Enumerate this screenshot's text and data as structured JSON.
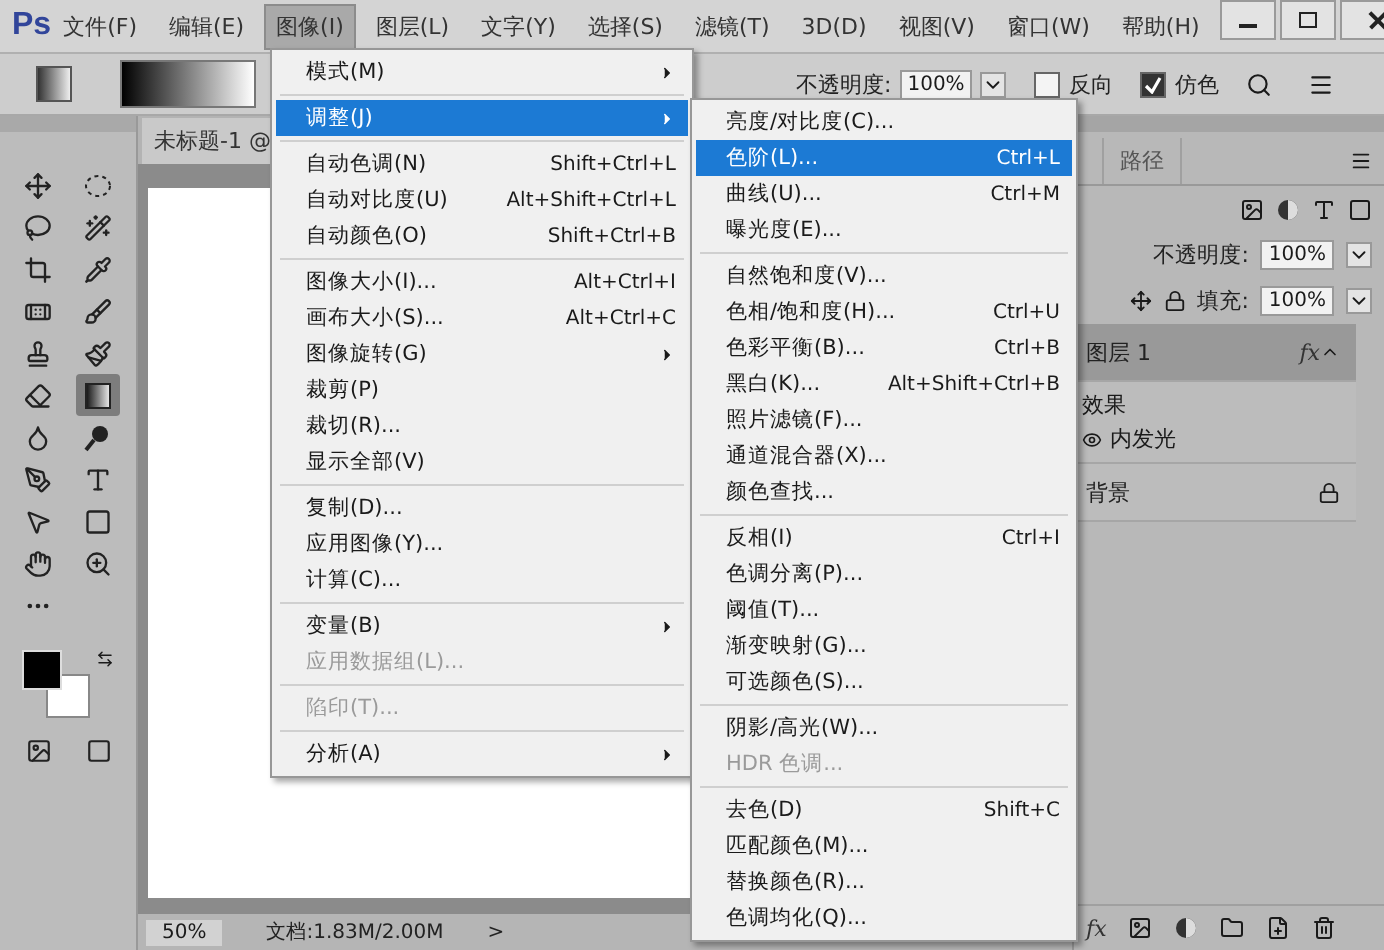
{
  "app": {
    "logo": "Ps"
  },
  "menu_bar": [
    {
      "label": "文件(F)",
      "selected": false
    },
    {
      "label": "编辑(E)",
      "selected": false
    },
    {
      "label": "图像(I)",
      "selected": true
    },
    {
      "label": "图层(L)",
      "selected": false
    },
    {
      "label": "文字(Y)",
      "selected": false
    },
    {
      "label": "选择(S)",
      "selected": false
    },
    {
      "label": "滤镜(T)",
      "selected": false
    },
    {
      "label": "3D(D)",
      "selected": false
    },
    {
      "label": "视图(V)",
      "selected": false
    },
    {
      "label": "窗口(W)",
      "selected": false
    },
    {
      "label": "帮助(H)",
      "selected": false
    }
  ],
  "options_bar": {
    "opacity_label": "不透明度:",
    "opacity": "100%",
    "checkboxes": [
      {
        "label": "反向",
        "checked": false
      },
      {
        "label": "仿色",
        "checked": true
      }
    ]
  },
  "toolbar": {
    "tools": [
      {
        "kind": "move",
        "selected": false
      },
      {
        "kind": "marquee",
        "selected": false
      },
      {
        "kind": "lasso",
        "selected": false
      },
      {
        "kind": "wand",
        "selected": false
      },
      {
        "kind": "crop",
        "selected": false
      },
      {
        "kind": "eyedropper",
        "selected": false
      },
      {
        "kind": "bandage",
        "selected": false
      },
      {
        "kind": "brush",
        "selected": false
      },
      {
        "kind": "stamp",
        "selected": false
      },
      {
        "kind": "history",
        "selected": false
      },
      {
        "kind": "eraser",
        "selected": false
      },
      {
        "kind": "gradient",
        "selected": true
      },
      {
        "kind": "drop",
        "selected": false
      },
      {
        "kind": "dodge",
        "selected": false
      },
      {
        "kind": "pen",
        "selected": false
      },
      {
        "kind": "type",
        "selected": false
      },
      {
        "kind": "pointer",
        "selected": false
      },
      {
        "kind": "rectangle",
        "selected": false
      },
      {
        "kind": "hand",
        "selected": false
      },
      {
        "kind": "zoom",
        "selected": false
      },
      {
        "kind": "more",
        "selected": false
      }
    ]
  },
  "document": {
    "tab": "未标题-1 @",
    "zoom": "50%",
    "info": "文档:1.83M/2.00M",
    "arrow": ">"
  },
  "image_menu": {
    "groups": [
      [
        {
          "label": "模式(M)",
          "submenu": true,
          "selected": false,
          "disabled": false
        }
      ],
      [
        {
          "label": "调整(J)",
          "submenu": true,
          "selected": true,
          "disabled": false
        }
      ],
      [
        {
          "label": "自动色调(N)",
          "shortcut": "Shift+Ctrl+L",
          "submenu": false,
          "selected": false,
          "disabled": false
        },
        {
          "label": "自动对比度(U)",
          "shortcut": "Alt+Shift+Ctrl+L",
          "submenu": false,
          "selected": false,
          "disabled": false
        },
        {
          "label": "自动颜色(O)",
          "shortcut": "Shift+Ctrl+B",
          "submenu": false,
          "selected": false,
          "disabled": false
        }
      ],
      [
        {
          "label": "图像大小(I)...",
          "shortcut": "Alt+Ctrl+I",
          "submenu": false,
          "selected": false,
          "disabled": false
        },
        {
          "label": "画布大小(S)...",
          "shortcut": "Alt+Ctrl+C",
          "submenu": false,
          "selected": false,
          "disabled": false
        },
        {
          "label": "图像旋转(G)",
          "submenu": true,
          "selected": false,
          "disabled": false
        },
        {
          "label": "裁剪(P)",
          "submenu": false,
          "selected": false,
          "disabled": false
        },
        {
          "label": "裁切(R)...",
          "submenu": false,
          "selected": false,
          "disabled": false
        },
        {
          "label": "显示全部(V)",
          "submenu": false,
          "selected": false,
          "disabled": false
        }
      ],
      [
        {
          "label": "复制(D)...",
          "submenu": false,
          "selected": false,
          "disabled": false
        },
        {
          "label": "应用图像(Y)...",
          "submenu": false,
          "selected": false,
          "disabled": false
        },
        {
          "label": "计算(C)...",
          "submenu": false,
          "selected": false,
          "disabled": false
        }
      ],
      [
        {
          "label": "变量(B)",
          "submenu": true,
          "selected": false,
          "disabled": false
        },
        {
          "label": "应用数据组(L)...",
          "submenu": false,
          "selected": false,
          "disabled": true
        }
      ],
      [
        {
          "label": "陷印(T)...",
          "submenu": false,
          "selected": false,
          "disabled": true
        }
      ],
      [
        {
          "label": "分析(A)",
          "submenu": true,
          "selected": false,
          "disabled": false
        }
      ]
    ]
  },
  "adjust_submenu": {
    "groups": [
      [
        {
          "label": "亮度/对比度(C)...",
          "selected": false,
          "disabled": false
        },
        {
          "label": "色阶(L)...",
          "shortcut": "Ctrl+L",
          "selected": true,
          "disabled": false
        },
        {
          "label": "曲线(U)...",
          "shortcut": "Ctrl+M",
          "selected": false,
          "disabled": false
        },
        {
          "label": "曝光度(E)...",
          "selected": false,
          "disabled": false
        }
      ],
      [
        {
          "label": "自然饱和度(V)...",
          "selected": false,
          "disabled": false
        },
        {
          "label": "色相/饱和度(H)...",
          "shortcut": "Ctrl+U",
          "selected": false,
          "disabled": false
        },
        {
          "label": "色彩平衡(B)...",
          "shortcut": "Ctrl+B",
          "selected": false,
          "disabled": false
        },
        {
          "label": "黑白(K)...",
          "shortcut": "Alt+Shift+Ctrl+B",
          "selected": false,
          "disabled": false
        },
        {
          "label": "照片滤镜(F)...",
          "selected": false,
          "disabled": false
        },
        {
          "label": "通道混合器(X)...",
          "selected": false,
          "disabled": false
        },
        {
          "label": "颜色查找...",
          "selected": false,
          "disabled": false
        }
      ],
      [
        {
          "label": "反相(I)",
          "shortcut": "Ctrl+I",
          "selected": false,
          "disabled": false
        },
        {
          "label": "色调分离(P)...",
          "selected": false,
          "disabled": false
        },
        {
          "label": "阈值(T)...",
          "selected": false,
          "disabled": false
        },
        {
          "label": "渐变映射(G)...",
          "selected": false,
          "disabled": false
        },
        {
          "label": "可选颜色(S)...",
          "selected": false,
          "disabled": false
        }
      ],
      [
        {
          "label": "阴影/高光(W)...",
          "selected": false,
          "disabled": false
        },
        {
          "label": "HDR 色调...",
          "selected": false,
          "disabled": true
        }
      ],
      [
        {
          "label": "去色(D)",
          "shortcut": "Shift+C",
          "selected": false,
          "disabled": false
        },
        {
          "label": "匹配颜色(M)...",
          "selected": false,
          "disabled": false
        },
        {
          "label": "替换颜色(R)...",
          "selected": false,
          "disabled": false
        },
        {
          "label": "色调均化(Q)...",
          "selected": false,
          "disabled": false
        }
      ]
    ]
  },
  "layers_panel": {
    "tab": "路径",
    "opacity_label": "不透明度:",
    "opacity": "100%",
    "fill_label": "填充:",
    "fill": "100%",
    "footer_fx": "fx",
    "layers": [
      {
        "name": "图层 1",
        "selected": true,
        "locked": false,
        "fx": "fx",
        "effects_label": "效果",
        "effects": [
          "内发光"
        ]
      },
      {
        "name": "背景",
        "selected": false,
        "locked": true
      }
    ]
  }
}
